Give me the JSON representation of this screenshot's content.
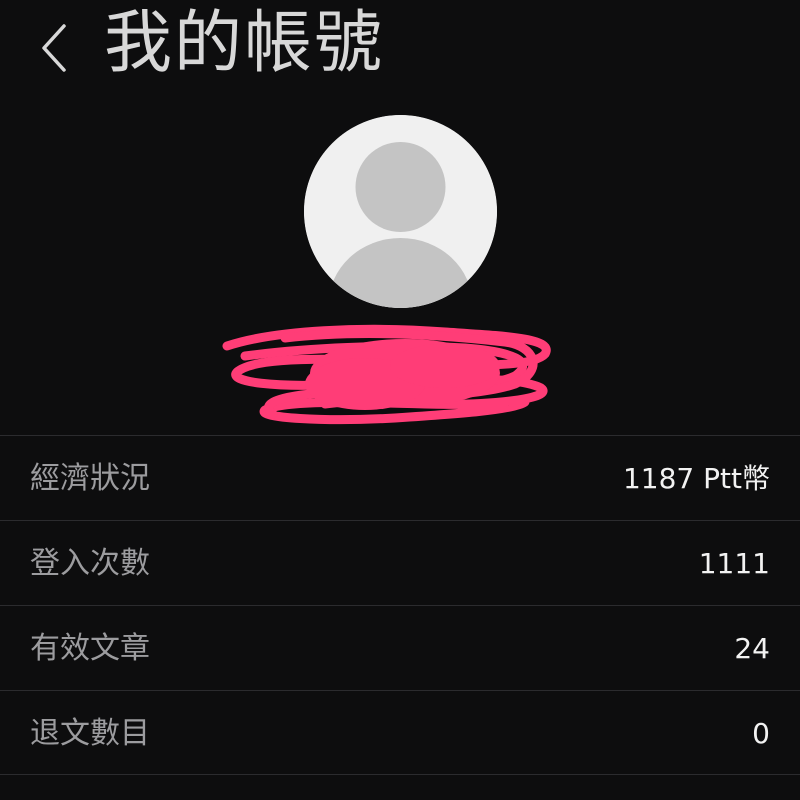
{
  "header": {
    "title": "我的帳號"
  },
  "profile": {
    "avatar_icon": "default-user-icon",
    "redaction_color": "#ff3d77"
  },
  "stats": [
    {
      "label": "經濟狀況",
      "value": "1187 Ptt幣"
    },
    {
      "label": "登入次數",
      "value": "1111"
    },
    {
      "label": "有效文章",
      "value": "24"
    },
    {
      "label": "退文數目",
      "value": "0"
    }
  ],
  "colors": {
    "background": "#0d0d0e",
    "divider": "#2b2b2e",
    "label": "#9c9c9f",
    "value": "#f2f2f2",
    "title": "#d8d8d8"
  }
}
